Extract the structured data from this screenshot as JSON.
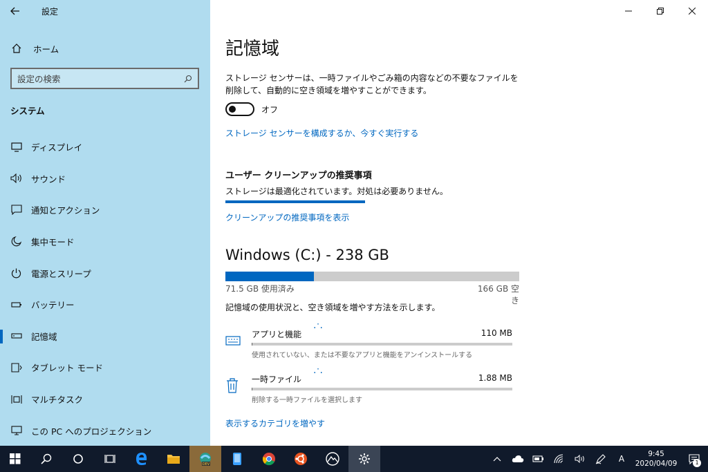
{
  "window": {
    "title": "設定"
  },
  "sidebar": {
    "home_label": "ホーム",
    "search_placeholder": "設定の検索",
    "section_title": "システム",
    "items": [
      {
        "label": "ディスプレイ",
        "icon": "monitor-icon"
      },
      {
        "label": "サウンド",
        "icon": "speaker-icon"
      },
      {
        "label": "通知とアクション",
        "icon": "message-icon"
      },
      {
        "label": "集中モード",
        "icon": "moon-icon"
      },
      {
        "label": "電源とスリープ",
        "icon": "power-icon"
      },
      {
        "label": "バッテリー",
        "icon": "battery-icon"
      },
      {
        "label": "記憶域",
        "icon": "storage-icon",
        "selected": true
      },
      {
        "label": "タブレット モード",
        "icon": "tablet-icon"
      },
      {
        "label": "マルチタスク",
        "icon": "multitask-icon"
      },
      {
        "label": "この PC へのプロジェクション",
        "icon": "projection-icon"
      }
    ]
  },
  "main": {
    "title": "記憶域",
    "description": "ストレージ センサーは、一時ファイルやごみ箱の内容などの不要なファイルを削除して、自動的に空き領域を増やすことができます。",
    "toggle_label": "オフ",
    "configure_link": "ストレージ センサーを構成するか、今すぐ実行する",
    "cleanup_heading": "ユーザー クリーンアップの推奨事項",
    "cleanup_status": "ストレージは最適化されています。対処は必要ありません。",
    "cleanup_link": "クリーンアップの推奨事項を表示",
    "drive": {
      "title": "Windows (C:) - 238 GB",
      "used_label": "71.5 GB 使用済み",
      "free_label": "166 GB 空き",
      "used_fraction": 0.3
    },
    "drive_description": "記憶域の使用状況と、空き領域を増やす方法を示します。",
    "categories": [
      {
        "name": "アプリと機能",
        "size": "110 MB",
        "subtitle": "使用されていない、または不要なアプリと機能をアンインストールする",
        "icon": "keyboard-icon",
        "fill_fraction": 0.003
      },
      {
        "name": "一時ファイル",
        "size": "1.88 MB",
        "subtitle": "削除する一時ファイルを選択します",
        "icon": "trash-icon",
        "fill_fraction": 0.001
      }
    ],
    "more_link": "表示するカテゴリを増やす"
  },
  "taskbar": {
    "clock_time": "9:45",
    "clock_date": "2020/04/09",
    "notification_count": "1",
    "ime_indicator": "A",
    "dev_badge": "DEV"
  },
  "colors": {
    "accent": "#0067c0",
    "sidebar_bg": "#b0dcef",
    "taskbar_bg": "#101a2b"
  }
}
